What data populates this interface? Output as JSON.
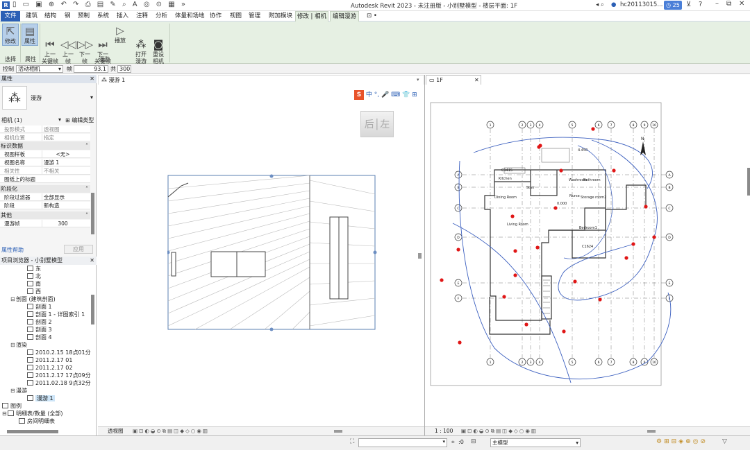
{
  "titlebar": {
    "title": "Autodesk Revit 2023 - 未注册版 - 小别墅模型 - 楼层平面: 1F",
    "user": "hc20113015...",
    "badge": "25"
  },
  "menu": [
    "文件",
    "建筑",
    "结构",
    "钢",
    "预制",
    "系统",
    "插入",
    "注释",
    "分析",
    "体量和场地",
    "协作",
    "视图",
    "管理",
    "附加模块",
    "修改 | 相机",
    "编辑漫游"
  ],
  "ribbon": {
    "buttons": [
      {
        "label": "修改",
        "icon": "cursor-icon"
      },
      {
        "label": "属性",
        "icon": "properties-icon"
      },
      {
        "label": "上一\n关键帧",
        "icon": "prev-keyframe-icon"
      },
      {
        "label": "上一\n帧",
        "icon": "prev-frame-icon"
      },
      {
        "label": "下一\n帧",
        "icon": "next-frame-icon"
      },
      {
        "label": "下一\n关键帧",
        "icon": "next-keyframe-icon"
      },
      {
        "label": "播放",
        "icon": "play-icon"
      },
      {
        "label": "打开\n漫游",
        "icon": "footsteps-icon"
      },
      {
        "label": "重设\n相机",
        "icon": "camera-icon"
      }
    ],
    "panels": [
      "选择",
      "属性",
      "漫游"
    ]
  },
  "optbar": {
    "control_label": "控制",
    "control_value": "活动相机",
    "frame_label": "帧",
    "frame_value": "93.1",
    "total_label": "共",
    "total_value": "300"
  },
  "properties": {
    "title": "属性",
    "type_name": "漫游",
    "instance": "相机 (1)",
    "edit_type": "编辑类型",
    "rows1": [
      {
        "k": "投影模式",
        "v": "透视图"
      },
      {
        "k": "相机位置",
        "v": "指定"
      }
    ],
    "sec_ident": "标识数据",
    "rows2": [
      {
        "k": "视图样板",
        "v": "<无>"
      },
      {
        "k": "视图名称",
        "v": "漫游 1"
      },
      {
        "k": "相关性",
        "v": "不相关"
      },
      {
        "k": "图纸上的标题",
        "v": ""
      }
    ],
    "sec_phase": "阶段化",
    "rows3": [
      {
        "k": "阶段过滤器",
        "v": "全部显示"
      },
      {
        "k": "阶段",
        "v": "新构造"
      }
    ],
    "sec_other": "其他",
    "rows4": [
      {
        "k": "漫游帧",
        "v": "300"
      }
    ],
    "help": "属性帮助",
    "apply": "应用"
  },
  "browser": {
    "title": "项目浏览器 - 小别墅模型",
    "items": [
      {
        "t": "东",
        "lvl": 3,
        "icon": true
      },
      {
        "t": "北",
        "lvl": 3,
        "icon": true
      },
      {
        "t": "南",
        "lvl": 3,
        "icon": true
      },
      {
        "t": "西",
        "lvl": 3,
        "icon": true
      },
      {
        "t": "剖面 (建筑剖面)",
        "lvl": 1,
        "tog": "⊟"
      },
      {
        "t": "剖面 1",
        "lvl": 3,
        "icon": true
      },
      {
        "t": "剖面 1 - 详图索引 1",
        "lvl": 3,
        "icon": true
      },
      {
        "t": "剖面 2",
        "lvl": 3,
        "icon": true
      },
      {
        "t": "剖面 3",
        "lvl": 3,
        "icon": true
      },
      {
        "t": "剖面 4",
        "lvl": 3,
        "icon": true
      },
      {
        "t": "渲染",
        "lvl": 1,
        "tog": "⊟"
      },
      {
        "t": "2010.2.15  18点01分",
        "lvl": 3,
        "icon": true
      },
      {
        "t": "2011.2.17 01",
        "lvl": 3,
        "icon": true
      },
      {
        "t": "2011.2.17 02",
        "lvl": 3,
        "icon": true
      },
      {
        "t": "2011.2.17  17点09分",
        "lvl": 3,
        "icon": true
      },
      {
        "t": "2011.02.18  9点32分",
        "lvl": 3,
        "icon": true
      },
      {
        "t": "漫游",
        "lvl": 1,
        "tog": "⊟"
      },
      {
        "t": "漫游 1",
        "lvl": 3,
        "icon": true,
        "sel": true
      },
      {
        "t": "图例",
        "lvl": 0,
        "icon": true
      },
      {
        "t": "明细表/数量 (全部)",
        "lvl": 0,
        "tog": "⊟",
        "icon": true
      },
      {
        "t": "房间明细表",
        "lvl": 2,
        "icon": true
      }
    ]
  },
  "views": {
    "walk_tab": "漫游 1",
    "plan_tab": "1F",
    "viewcube": {
      "a": "后",
      "b": "左"
    },
    "ime": [
      "中",
      "°,",
      "🎤",
      "⌨",
      "👕",
      "⊞"
    ],
    "walk_status": "透视图",
    "plan_scale": "1 : 100"
  },
  "plan": {
    "rooms": [
      "Kitchen",
      "Stair",
      "Dining Room",
      "Washroom",
      "Bathroom",
      "Nurse",
      "Storage room2",
      "Living Room",
      "Bedroom1"
    ],
    "grid_top": [
      "1",
      "2",
      "3",
      "4",
      "5",
      "6",
      "7",
      "8",
      "9",
      "10"
    ],
    "grid_left": [
      "A",
      "B",
      "C",
      "D",
      "E",
      "F",
      "G",
      "H"
    ],
    "texts": [
      "4.450",
      "0.000",
      "C1415",
      "C1624"
    ]
  },
  "status": {
    "model": "主模型",
    "zero": ":0"
  }
}
